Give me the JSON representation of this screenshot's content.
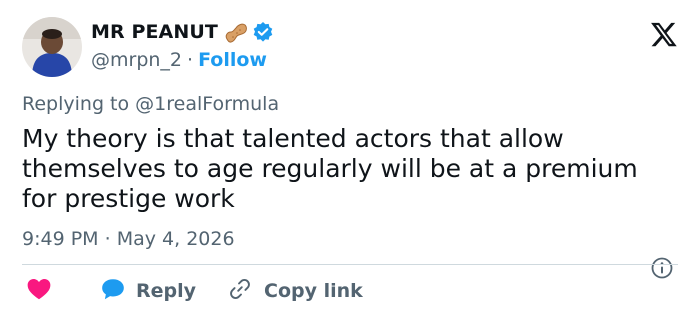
{
  "author": {
    "display_name": "MR PEANUT",
    "handle": "@mrpn_2",
    "separator": "·",
    "follow_label": "Follow"
  },
  "tweet": {
    "replying_prefix": "Replying to",
    "replying_to": "@1realFormula",
    "text": "My theory is that talented actors that allow themselves to age regularly will be at a premium for prestige work",
    "time": "9:49 PM",
    "date_separator": "·",
    "date": "May 4, 2026"
  },
  "actions": {
    "reply_label": "Reply",
    "copy_label": "Copy link"
  },
  "icons": {
    "like": "heart-icon",
    "reply": "speech-bubble-icon",
    "copy": "link-icon",
    "info": "info-icon",
    "brand": "x-logo-icon",
    "verified": "verified-badge-icon",
    "emoji": "peanut-emoji-icon"
  },
  "colors": {
    "accent": "#1d9bf0",
    "like": "#f91880",
    "text": "#0f1419",
    "muted": "#536471",
    "divider": "#cfd9de"
  }
}
